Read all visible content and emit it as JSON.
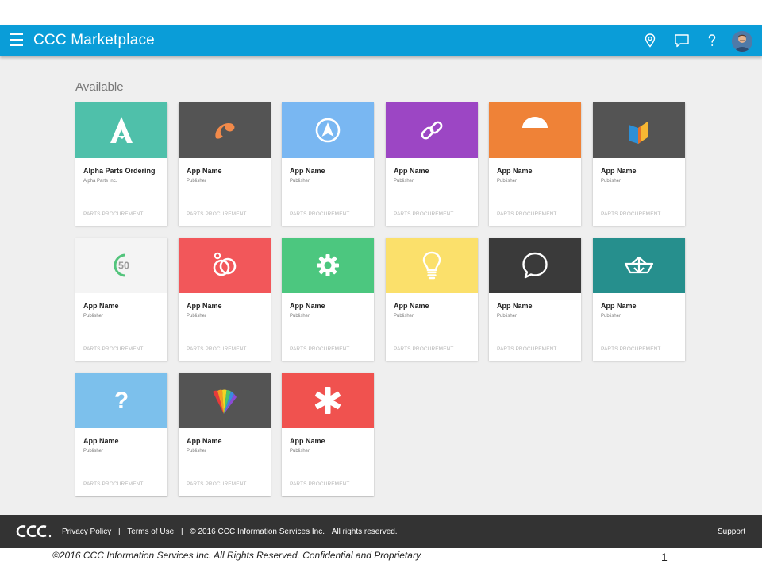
{
  "header": {
    "title": "CCC Marketplace",
    "icons": [
      "location-pin-icon",
      "chat-icon",
      "help-icon"
    ]
  },
  "main": {
    "section_title": "Available",
    "cards": [
      {
        "name": "Alpha Parts Ordering",
        "publisher": "Alpha Parts Inc.",
        "category": "PARTS PROCUREMENT",
        "color": "#4fc0aa",
        "icon": "letter-a-icon"
      },
      {
        "name": "App Name",
        "publisher": "Publisher",
        "category": "PARTS PROCUREMENT",
        "color": "#545454",
        "icon": "orange-swirl-icon"
      },
      {
        "name": "App Name",
        "publisher": "Publisher",
        "category": "PARTS PROCUREMENT",
        "color": "#79b7f2",
        "icon": "navigation-arrow-icon"
      },
      {
        "name": "App Name",
        "publisher": "Publisher",
        "category": "PARTS PROCUREMENT",
        "color": "#9c46c4",
        "icon": "link-icon"
      },
      {
        "name": "App Name",
        "publisher": "Publisher",
        "category": "PARTS PROCUREMENT",
        "color": "#ef8237",
        "icon": "half-circle-icon"
      },
      {
        "name": "App Name",
        "publisher": "Publisher",
        "category": "PARTS PROCUREMENT",
        "color": "#545454",
        "icon": "book-icon"
      },
      {
        "name": "App Name",
        "publisher": "Publisher",
        "category": "PARTS PROCUREMENT",
        "color": "#f4f4f4",
        "icon": "fifty-icon"
      },
      {
        "name": "App Name",
        "publisher": "Publisher",
        "category": "PARTS PROCUREMENT",
        "color": "#f2575a",
        "icon": "rings-icon"
      },
      {
        "name": "App Name",
        "publisher": "Publisher",
        "category": "PARTS PROCUREMENT",
        "color": "#4cc77f",
        "icon": "gear-icon"
      },
      {
        "name": "App Name",
        "publisher": "Publisher",
        "category": "PARTS PROCUREMENT",
        "color": "#fbe06b",
        "icon": "lightbulb-icon"
      },
      {
        "name": "App Name",
        "publisher": "Publisher",
        "category": "PARTS PROCUREMENT",
        "color": "#3a3a3a",
        "icon": "speech-bubble-icon"
      },
      {
        "name": "App Name",
        "publisher": "Publisher",
        "category": "PARTS PROCUREMENT",
        "color": "#268f8d",
        "icon": "paper-boat-icon"
      },
      {
        "name": "App Name",
        "publisher": "Publisher",
        "category": "PARTS PROCUREMENT",
        "color": "#7cc0ec",
        "icon": "question-mark-icon"
      },
      {
        "name": "App Name",
        "publisher": "Publisher",
        "category": "PARTS PROCUREMENT",
        "color": "#545454",
        "icon": "rainbow-fan-icon"
      },
      {
        "name": "App Name",
        "publisher": "Publisher",
        "category": "PARTS PROCUREMENT",
        "color": "#f0524f",
        "icon": "asterisk-icon"
      }
    ]
  },
  "footer": {
    "privacy": "Privacy Policy",
    "sep1": "|",
    "terms": "Terms of Use",
    "sep2": "|",
    "copyright": "© 2016 CCC Information Services Inc.",
    "rights": "All rights reserved.",
    "support": "Support"
  },
  "confidential": "©2016 CCC Information Services Inc. All Rights Reserved. Confidential and Proprietary.",
  "page_number": "1"
}
